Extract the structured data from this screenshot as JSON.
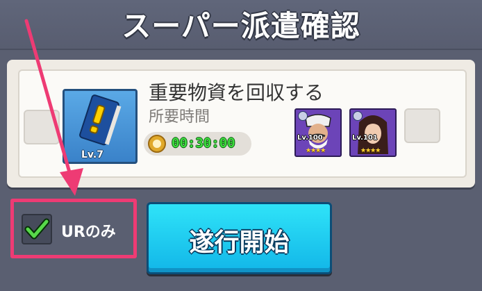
{
  "header": {
    "title": "スーパー派遣確認"
  },
  "mission": {
    "name": "重要物資を回収する",
    "level_label": "Lv.7",
    "required_time_label": "所要時間",
    "duration": "00:30:00"
  },
  "heroes": [
    {
      "level_label": "Lv.100",
      "stars": "★★★★"
    },
    {
      "level_label": "Lv.101",
      "stars": "★★★★"
    }
  ],
  "filter": {
    "label": "URのみ",
    "checked": true
  },
  "start_button": {
    "label": "遂行開始"
  },
  "colors": {
    "background": "#5a5f71",
    "start_button": "#1fc8f2",
    "highlight": "#ee3b74",
    "timer_text": "#3fdc3f"
  }
}
